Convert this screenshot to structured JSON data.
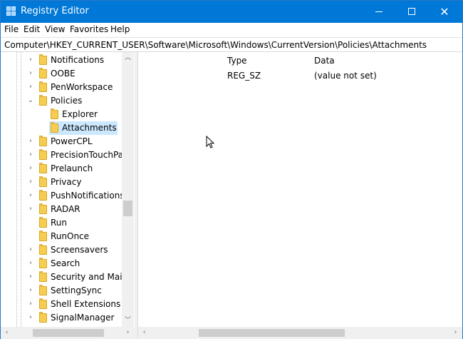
{
  "window": {
    "title": "Registry Editor",
    "controls": {
      "minimize": "minimize",
      "maximize": "maximize",
      "close": "✕"
    }
  },
  "menu": [
    {
      "label": "File"
    },
    {
      "label": "Edit"
    },
    {
      "label": "View"
    },
    {
      "label": "Favorites"
    },
    {
      "label": "Help"
    }
  ],
  "address": {
    "path": "Computer\\HKEY_CURRENT_USER\\Software\\Microsoft\\Windows\\CurrentVersion\\Policies\\Attachments"
  },
  "tree": {
    "items": [
      {
        "label": "Notifications",
        "expander": "›",
        "level": 0
      },
      {
        "label": "OOBE",
        "expander": "›",
        "level": 0
      },
      {
        "label": "PenWorkspace",
        "expander": "›",
        "level": 0
      },
      {
        "label": "Policies",
        "expander": "⌄",
        "level": 0
      },
      {
        "label": "Explorer",
        "expander": "",
        "level": 1
      },
      {
        "label": "Attachments",
        "expander": "",
        "level": 1,
        "selected": true
      },
      {
        "label": "PowerCPL",
        "expander": "›",
        "level": 0
      },
      {
        "label": "PrecisionTouchPad",
        "expander": "›",
        "level": 0
      },
      {
        "label": "Prelaunch",
        "expander": "›",
        "level": 0
      },
      {
        "label": "Privacy",
        "expander": "›",
        "level": 0
      },
      {
        "label": "PushNotifications",
        "expander": "›",
        "level": 0
      },
      {
        "label": "RADAR",
        "expander": "›",
        "level": 0
      },
      {
        "label": "Run",
        "expander": "",
        "level": 0
      },
      {
        "label": "RunOnce",
        "expander": "",
        "level": 0
      },
      {
        "label": "Screensavers",
        "expander": "›",
        "level": 0
      },
      {
        "label": "Search",
        "expander": "›",
        "level": 0
      },
      {
        "label": "Security and Maint",
        "expander": "›",
        "level": 0
      },
      {
        "label": "SettingSync",
        "expander": "›",
        "level": 0
      },
      {
        "label": "Shell Extensions",
        "expander": "›",
        "level": 0
      },
      {
        "label": "SignalManager",
        "expander": "›",
        "level": 0
      }
    ]
  },
  "values": {
    "columns": {
      "type": "Type",
      "data": "Data"
    },
    "rows": [
      {
        "type": "REG_SZ",
        "data": "(value not set)"
      }
    ]
  },
  "colors": {
    "titlebar": "#0078d7",
    "selection": "#cce8ff",
    "folder": "#f6cd4f"
  },
  "icons": {
    "app": "registry-editor-icon",
    "folder": "folder-icon",
    "expand": "chevron-right-icon",
    "collapse": "chevron-down-icon"
  }
}
